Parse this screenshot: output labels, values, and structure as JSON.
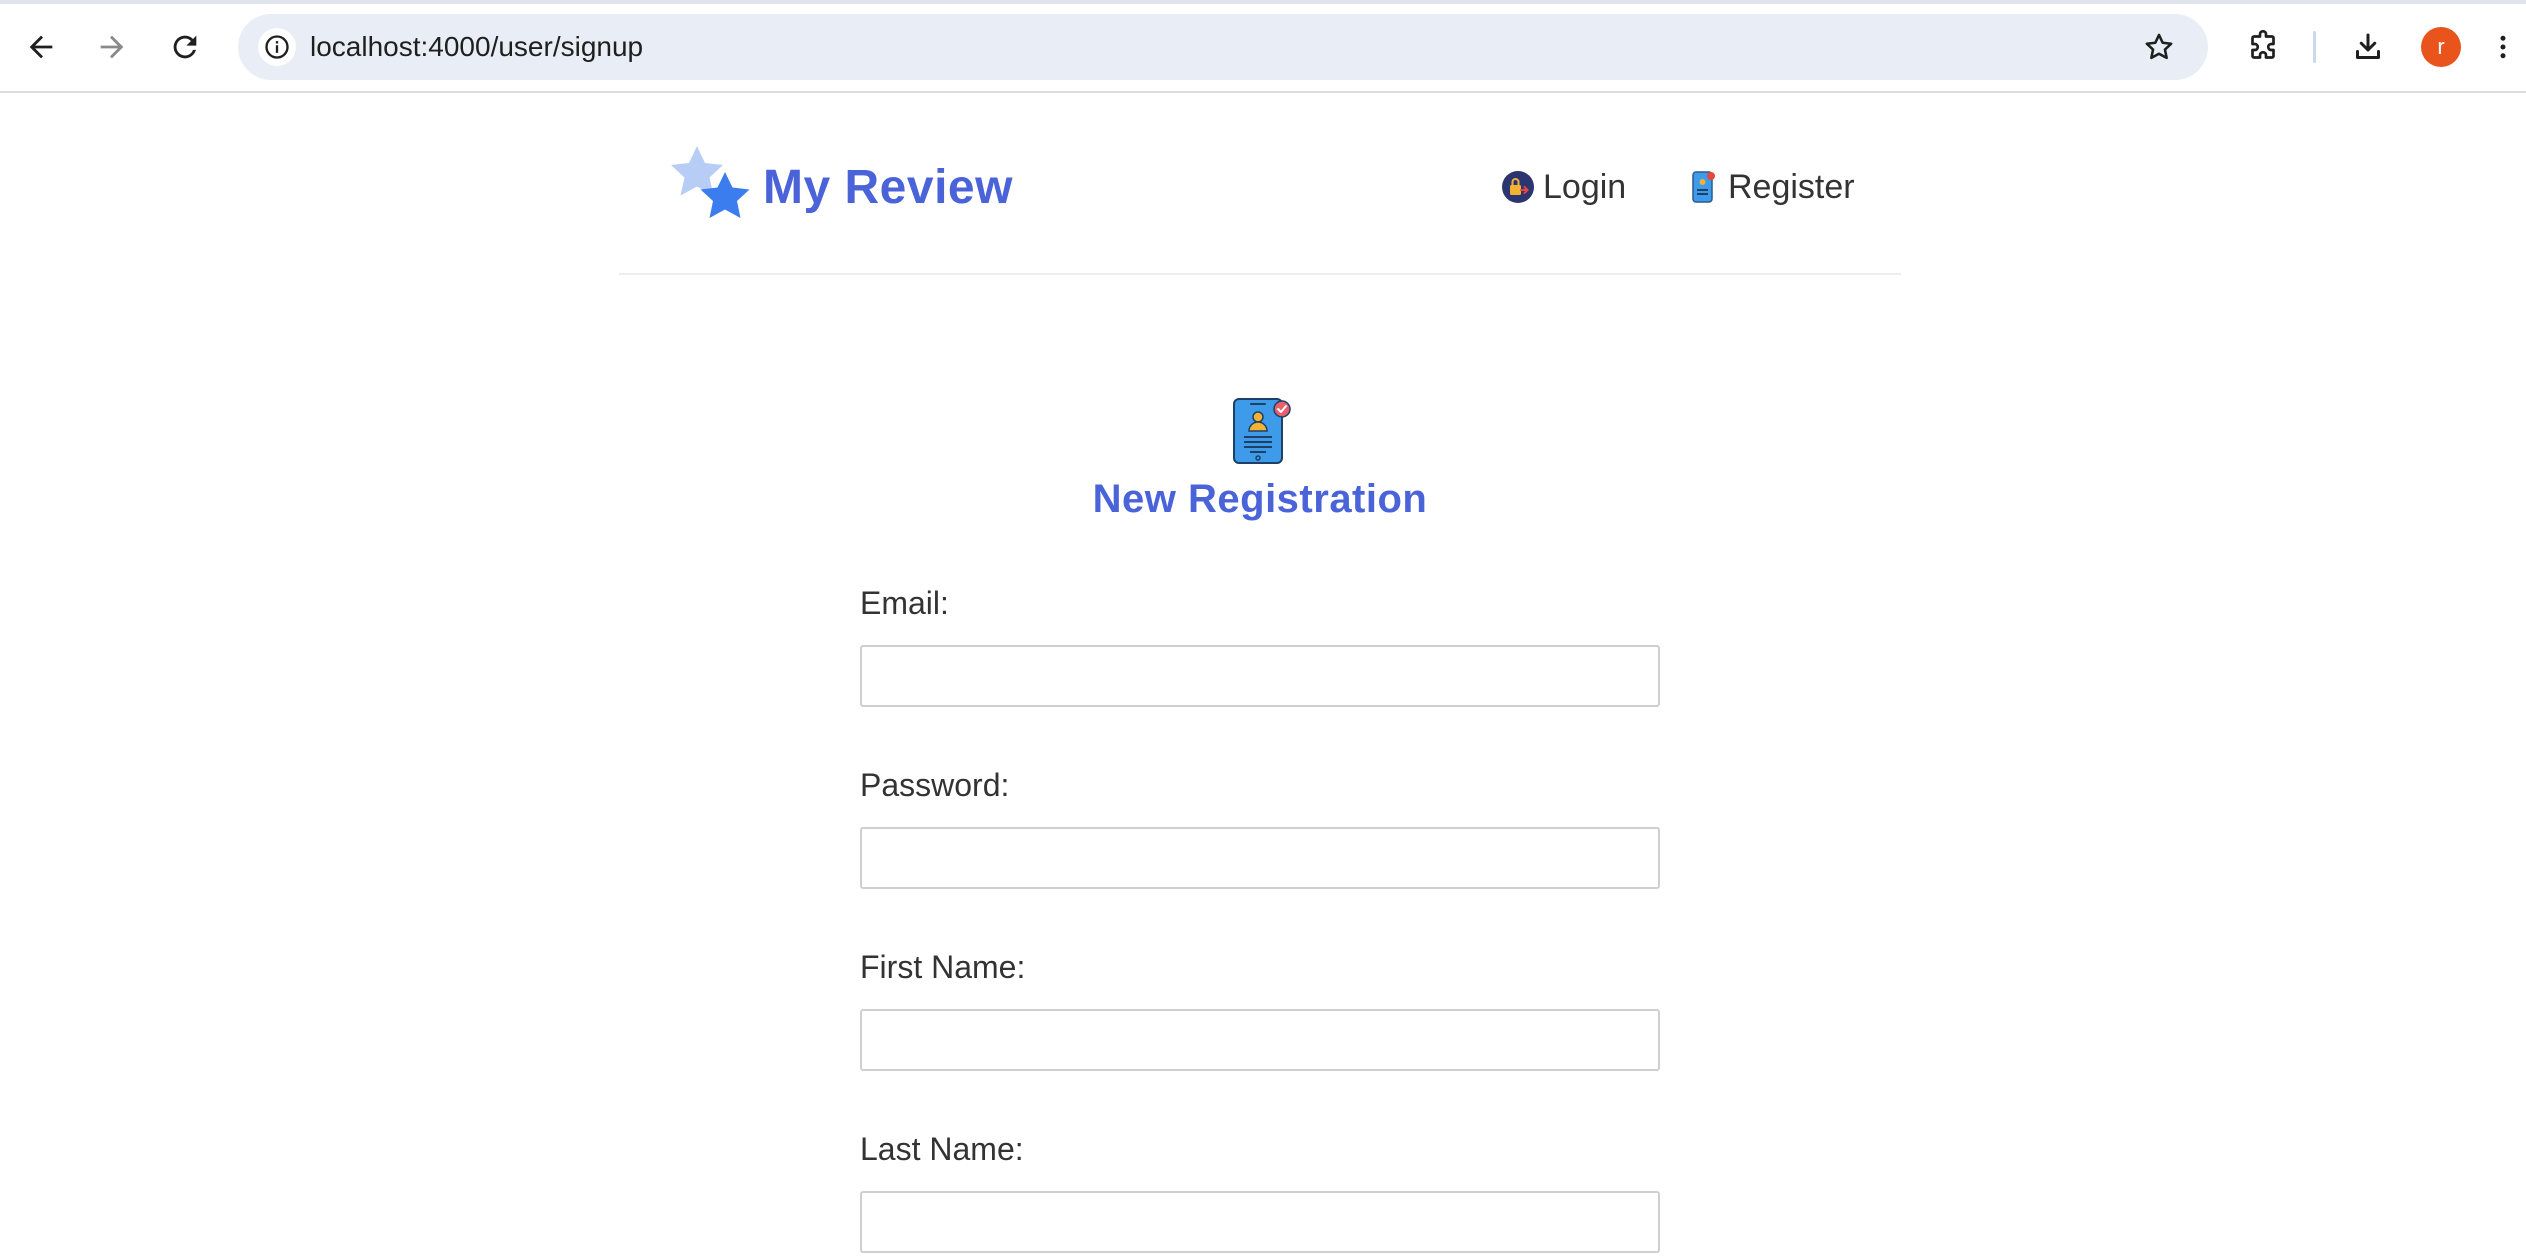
{
  "browser": {
    "url": "localhost:4000/user/signup",
    "profile_initial": "r",
    "accent_color": "#e8541c"
  },
  "site": {
    "brand_title": "My Review",
    "brand_color": "#4a63d9",
    "nav": {
      "login_label": "Login",
      "register_label": "Register"
    }
  },
  "form": {
    "title": "New Registration",
    "fields": [
      {
        "label": "Email:",
        "value": "",
        "placeholder": ""
      },
      {
        "label": "Password:",
        "value": "",
        "placeholder": ""
      },
      {
        "label": "First Name:",
        "value": "",
        "placeholder": ""
      },
      {
        "label": "Last Name:",
        "value": "",
        "placeholder": ""
      }
    ]
  }
}
